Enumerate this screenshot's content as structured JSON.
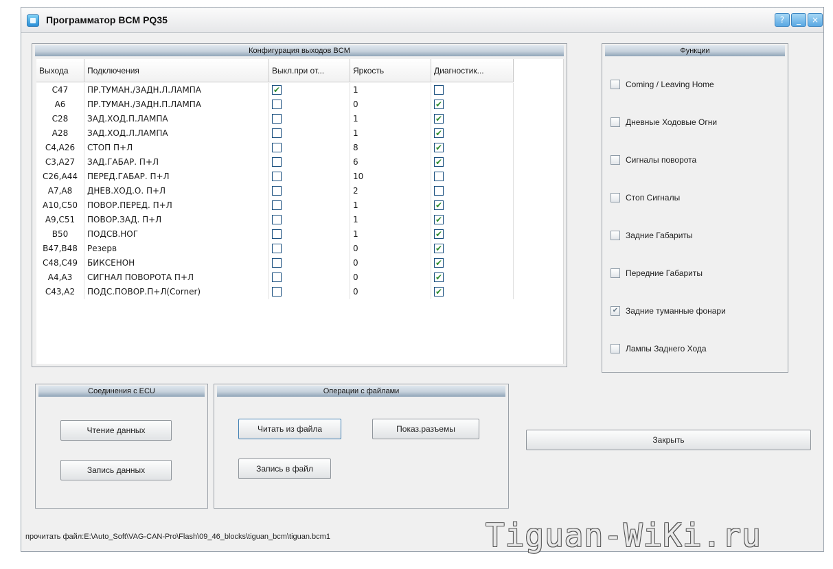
{
  "window": {
    "title": "Программатор BCM PQ35",
    "title_buttons": [
      "?",
      "_",
      "×"
    ]
  },
  "config_group": {
    "title": "Конфигурация выходов BCM",
    "columns": [
      "Выхода",
      "Подключения",
      "Выкл.при от...",
      "Яркость",
      "Диагностик..."
    ],
    "rows": [
      {
        "output": "C47",
        "connection": "ПР.ТУМАН./ЗАДН.Л.ЛАМПА",
        "off_when": true,
        "brightness": "1",
        "diag": false
      },
      {
        "output": "A6",
        "connection": "ПР.ТУМАН./ЗАДН.П.ЛАМПА",
        "off_when": false,
        "brightness": "0",
        "diag": true
      },
      {
        "output": "C28",
        "connection": "ЗАД.ХОД.П.ЛАМПА",
        "off_when": false,
        "brightness": "1",
        "diag": true
      },
      {
        "output": "A28",
        "connection": "ЗАД.ХОД.Л.ЛАМПА",
        "off_when": false,
        "brightness": "1",
        "diag": true
      },
      {
        "output": "C4,A26",
        "connection": "СТОП П+Л",
        "off_when": false,
        "brightness": "8",
        "diag": true
      },
      {
        "output": "C3,A27",
        "connection": "ЗАД.ГАБАР. П+Л",
        "off_when": false,
        "brightness": "6",
        "diag": true
      },
      {
        "output": "C26,A44",
        "connection": "ПЕРЕД.ГАБАР. П+Л",
        "off_when": false,
        "brightness": "10",
        "diag": false
      },
      {
        "output": "A7,A8",
        "connection": "ДНЕВ.ХОД.О. П+Л",
        "off_when": false,
        "brightness": "2",
        "diag": false
      },
      {
        "output": "A10,C50",
        "connection": "ПОВОР.ПЕРЕД. П+Л",
        "off_when": false,
        "brightness": "1",
        "diag": true
      },
      {
        "output": "A9,C51",
        "connection": "ПОВОР.ЗАД. П+Л",
        "off_when": false,
        "brightness": "1",
        "diag": true
      },
      {
        "output": "B50",
        "connection": "ПОДСВ.НОГ",
        "off_when": false,
        "brightness": "1",
        "diag": true
      },
      {
        "output": "B47,B48",
        "connection": "Резерв",
        "off_when": false,
        "brightness": "0",
        "diag": true
      },
      {
        "output": "C48,C49",
        "connection": "БИКСЕНОН",
        "off_when": false,
        "brightness": "0",
        "diag": true
      },
      {
        "output": "A4,A3",
        "connection": "СИГНАЛ ПОВОРОТА П+Л",
        "off_when": false,
        "brightness": "0",
        "diag": true
      },
      {
        "output": "C43,A2",
        "connection": "ПОДС.ПОВОР.П+Л(Corner)",
        "off_when": false,
        "brightness": "0",
        "diag": true
      }
    ]
  },
  "functions_group": {
    "title": "Функции",
    "items": [
      {
        "label": "Coming / Leaving Home",
        "checked": false
      },
      {
        "label": "Дневные Ходовые Огни",
        "checked": false
      },
      {
        "label": "Сигналы поворота",
        "checked": false
      },
      {
        "label": "Стоп Сигналы",
        "checked": false
      },
      {
        "label": "Задние Габариты",
        "checked": false
      },
      {
        "label": "Передние Габариты",
        "checked": false
      },
      {
        "label": "Задние туманные фонари",
        "checked": true
      },
      {
        "label": "Лампы Заднего Хода",
        "checked": false
      }
    ]
  },
  "ecu_group": {
    "title": "Соединения с ECU",
    "read_button": "Чтение данных",
    "write_button": "Запись данных"
  },
  "file_group": {
    "title": "Операции с файлами",
    "read_file_button": "Читать из файла",
    "show_connectors_button": "Показ.разъемы",
    "write_file_button": "Запись в файл"
  },
  "close_button": "Закрыть",
  "status_bar": "прочитать файл:E:\\Auto_Soft\\VAG-CAN-Pro\\Flash\\09_46_blocks\\tiguan_bcm\\tiguan.bcm1",
  "watermark": "Tiguan-WiKi.ru"
}
